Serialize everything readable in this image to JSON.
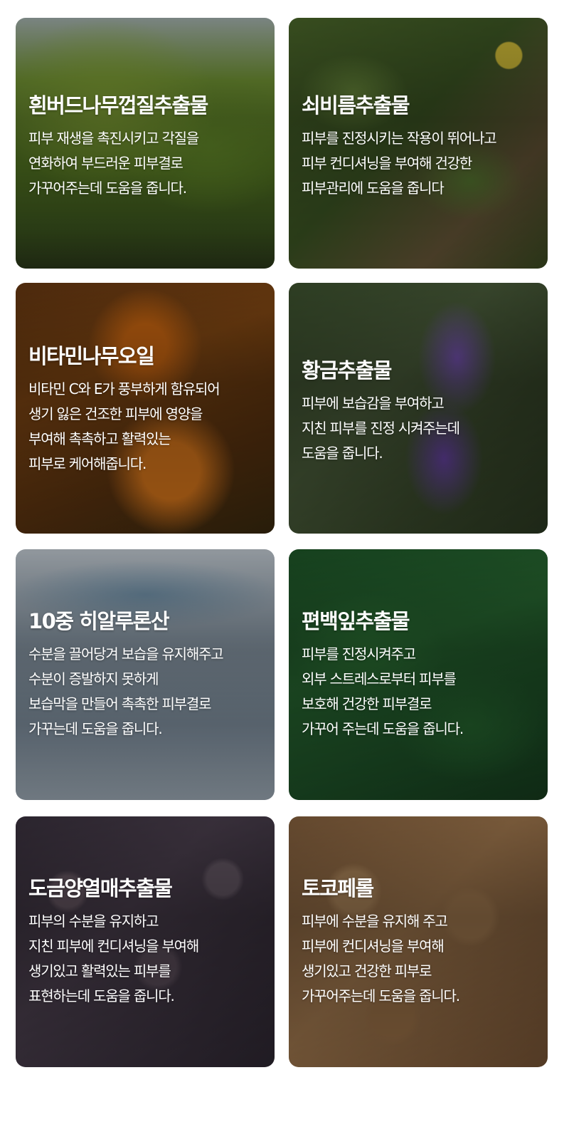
{
  "cards": [
    {
      "title": "흰버드나무껍질추출물",
      "description": "피부 재생을 촉진시키고 각질을\n연화하여 부드러운 피부결로\n가꾸어주는데 도움을 줍니다.",
      "image": "willow-tree"
    },
    {
      "title": "쇠비름추출물",
      "description": "피부를 진정시키는 작용이 뛰어나고\n피부 컨디셔닝을 부여해 건강한\n피부관리에 도움을 줍니다",
      "image": "purslane-leaves"
    },
    {
      "title": "비타민나무오일",
      "description": "비타민 C와 E가 풍부하게 함유되어\n생기 잃은 건조한 피부에 영양을\n부여해 촉촉하고 활력있는\n피부로 케어해줍니다.",
      "image": "sea-buckthorn-berries"
    },
    {
      "title": "황금추출물",
      "description": "피부에 보습감을 부여하고\n지친 피부를 진정 시켜주는데\n도움을 줍니다.",
      "image": "purple-skullcap-flower"
    },
    {
      "title": "10중 히알루론산",
      "description": "수분을 끌어당겨 보습을 유지해주고\n수분이 증발하지 못하게\n보습막을 만들어 촉촉한 피부결로\n가꾸는데 도움을 줍니다.",
      "image": "water-splash"
    },
    {
      "title": "편백잎추출물",
      "description": "피부를 진정시켜주고\n외부 스트레스로부터 피부를\n보호해 건강한 피부결로\n가꾸어 주는데 도움을 줍니다.",
      "image": "cypress-leaves"
    },
    {
      "title": "도금양열매추출물",
      "description": "피부의 수분을 유지하고\n지친 피부에 컨디셔닝을 부여해\n생기있고 활력있는 피부를\n표현하는데 도움을 줍니다.",
      "image": "myrtle-berries"
    },
    {
      "title": "토코페롤",
      "description": "피부에 수분을 유지해 주고\n피부에 컨디셔닝을 부여해\n생기있고 건강한 피부로\n가꾸어주는데 도움을 줍니다.",
      "image": "tiger-nuts"
    }
  ]
}
